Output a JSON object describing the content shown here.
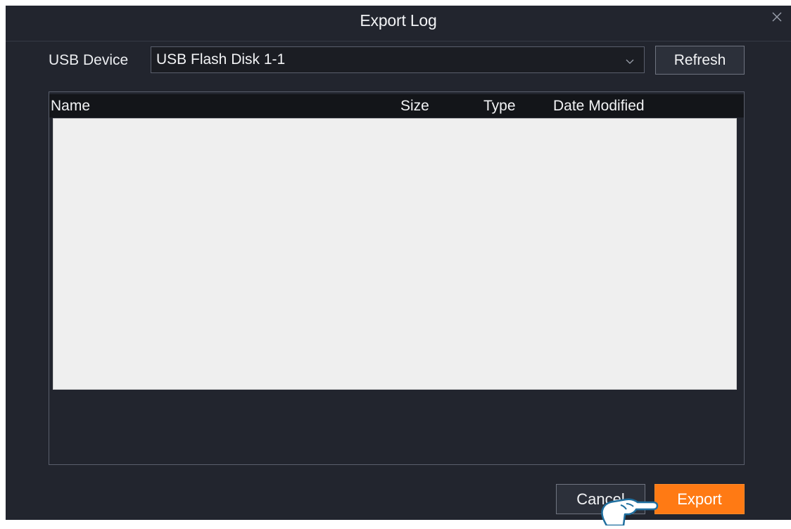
{
  "dialog": {
    "title": "Export Log",
    "close_icon": "close-icon"
  },
  "usb": {
    "label": "USB Device",
    "selected_device": "USB Flash Disk 1-1",
    "dropdown_icon": "chevron-down-icon",
    "refresh_label": "Refresh"
  },
  "file_table": {
    "columns": [
      "Name",
      "Size",
      "Type",
      "Date Modified"
    ],
    "rows": []
  },
  "footer": {
    "cancel_label": "Cancel",
    "export_label": "Export"
  },
  "overlay": {
    "pointer_icon": "pointing-hand-icon"
  },
  "colors": {
    "background": "#22252e",
    "header_bar": "#131519",
    "list_background": "#efefef",
    "accent": "#ff7a14",
    "text": "#f2f3f5"
  }
}
